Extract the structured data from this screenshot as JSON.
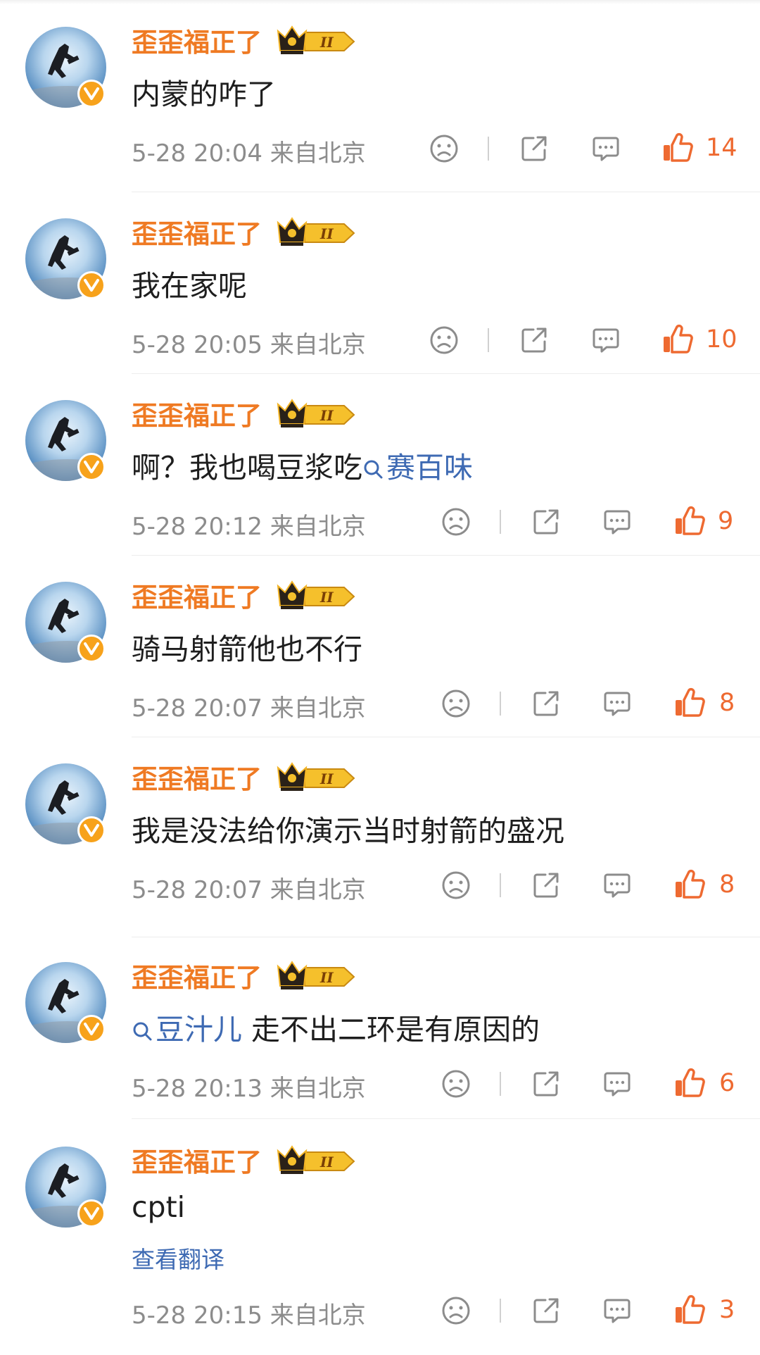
{
  "comments": [
    {
      "username": "歪歪福正了",
      "text_plain": "内蒙的咋了",
      "time": "5-28 20:04",
      "location": "来自北京",
      "likes": "14"
    },
    {
      "username": "歪歪福正了",
      "text_plain": "我在家呢",
      "time": "5-28 20:05",
      "location": "来自北京",
      "likes": "10"
    },
    {
      "username": "歪歪福正了",
      "text_plain": "啊？我也喝豆浆吃",
      "topic": "赛百味",
      "time": "5-28 20:12",
      "location": "来自北京",
      "likes": "9"
    },
    {
      "username": "歪歪福正了",
      "text_plain": "骑马射箭他也不行",
      "time": "5-28 20:07",
      "location": "来自北京",
      "likes": "8"
    },
    {
      "username": "歪歪福正了",
      "text_plain": "我是没法给你演示当时射箭的盛况",
      "time": "5-28 20:07",
      "location": "来自北京",
      "likes": "8"
    },
    {
      "username": "歪歪福正了",
      "topic": "豆汁儿",
      "text_plain": " 走不出二环是有原因的",
      "time": "5-28 20:13",
      "location": "来自北京",
      "likes": "6"
    },
    {
      "username": "歪歪福正了",
      "text_plain": "cpti",
      "translate_label": "查看翻译",
      "time": "5-28 20:15",
      "location": "来自北京",
      "likes": "3"
    }
  ],
  "badge": {
    "level": "II"
  },
  "colors": {
    "username": "#ef7a23",
    "link": "#3e6ab3",
    "like": "#ee6a31",
    "meta": "#8c8c8c"
  },
  "icons": [
    "dislike-icon",
    "share-icon",
    "reply-icon",
    "like-icon",
    "crown-badge-icon",
    "verified-v-icon",
    "topic-search-icon"
  ]
}
